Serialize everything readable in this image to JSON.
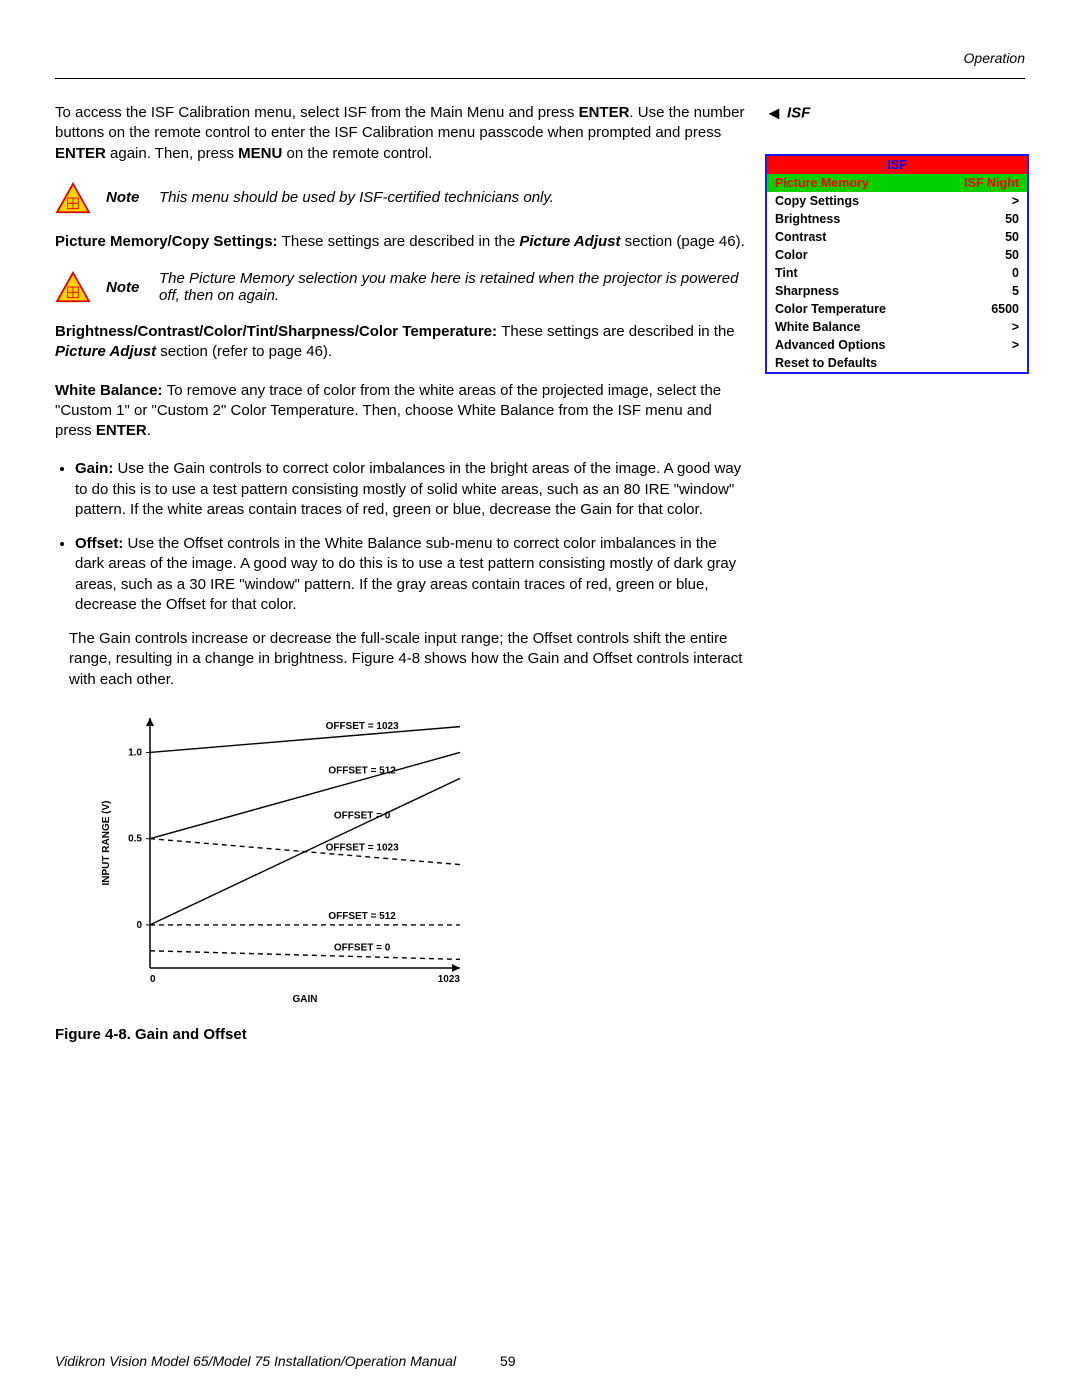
{
  "header": {
    "section": "Operation"
  },
  "side": {
    "heading": "ISF",
    "menu_title": "ISF",
    "highlight": {
      "label": "Picture Memory",
      "value": "ISF Night"
    },
    "rows": [
      {
        "label": "Copy Settings",
        "value": ">"
      },
      {
        "label": "Brightness",
        "value": "50"
      },
      {
        "label": "Contrast",
        "value": "50"
      },
      {
        "label": "Color",
        "value": "50"
      },
      {
        "label": "Tint",
        "value": "0"
      },
      {
        "label": "Sharpness",
        "value": "5"
      },
      {
        "label": "Color Temperature",
        "value": "6500"
      },
      {
        "label": "White Balance",
        "value": ">"
      },
      {
        "label": "Advanced Options",
        "value": ">"
      },
      {
        "label": "Reset to Defaults",
        "value": ""
      }
    ]
  },
  "intro": {
    "p1a": "To access the ISF Calibration menu, select ISF from the Main Menu and press ",
    "p1b": ". Use the number buttons on the remote control to enter the ISF Calibration menu passcode when prompted and press ",
    "p1c": " again. Then, press ",
    "p1d": " on the remote control.",
    "enter": "ENTER",
    "menu": "MENU"
  },
  "note1": "This menu should be used by ISF-certified technicians only.",
  "pm_copy": {
    "lead": "Picture Memory/Copy Settings: ",
    "body": "These settings are described in the ",
    "ref": "Picture Adjust",
    "tail": " section (page 46)."
  },
  "note2": "The Picture Memory selection you make here is retained when the projector is powered off, then on again.",
  "bcctsc": {
    "lead": "Brightness/Contrast/Color/Tint/Sharpness/Color Temperature: ",
    "body": "These settings are described in the ",
    "ref": "Picture Adjust",
    "tail": " section (refer to page 46)."
  },
  "wb": {
    "lead": "White Balance: ",
    "body": "To remove any trace of color from the white areas of the projected image, select the \"Custom 1\" or \"Custom 2\" Color Temperature. Then, choose White Balance from the ISF menu and press ",
    "enter": "ENTER",
    "tail": "."
  },
  "bullets": {
    "gain_lead": "Gain: ",
    "gain": "Use the Gain controls to correct color imbalances in the bright areas of the image. A good way to do this is to use a test pattern consisting mostly of solid white areas, such as an 80 IRE \"window\" pattern. If the white areas contain traces of red, green or blue, decrease the Gain for that color.",
    "offset_lead": "Offset: ",
    "offset": "Use the Offset controls in the White Balance sub-menu to correct color imbalances in the dark areas of the image. A good way to do this is to use a test pattern consisting mostly of dark gray areas, such as a 30 IRE \"window\" pattern. If the gray areas contain traces of red, green or blue, decrease the Offset for that color."
  },
  "gain_offset_para": "The Gain controls increase or decrease the full-scale input range; the Offset controls shift the entire range, resulting in a change in brightness. Figure 4-8 shows how the Gain and Offset controls interact with each other.",
  "fig_caption": "Figure 4-8. Gain and Offset",
  "footer": {
    "title": "Vidikron Vision Model 65/Model 75 Installation/Operation Manual",
    "page": "59"
  },
  "chart_data": {
    "type": "line",
    "title": "",
    "xlabel": "GAIN",
    "ylabel": "INPUT RANGE (V)",
    "xlim": [
      0,
      1023
    ],
    "ylim": [
      -0.25,
      1.2
    ],
    "y_ticks": [
      "0",
      "0.5",
      "1.0"
    ],
    "x_ticks": [
      "0",
      "1023"
    ],
    "series": [
      {
        "name": "OFFSET = 1023",
        "style": "solid",
        "points": [
          [
            0,
            1.0
          ],
          [
            1023,
            1.15
          ]
        ]
      },
      {
        "name": "OFFSET = 512",
        "style": "solid",
        "points": [
          [
            0,
            0.5
          ],
          [
            1023,
            1.0
          ]
        ]
      },
      {
        "name": "OFFSET = 0",
        "style": "solid",
        "points": [
          [
            0,
            0.0
          ],
          [
            1023,
            0.85
          ]
        ]
      },
      {
        "name": "OFFSET = 1023",
        "style": "dashed",
        "points": [
          [
            0,
            0.5
          ],
          [
            1023,
            0.35
          ]
        ]
      },
      {
        "name": "OFFSET = 512",
        "style": "dashed",
        "points": [
          [
            0,
            0.0
          ],
          [
            1023,
            0.0
          ]
        ]
      },
      {
        "name": "OFFSET = 0",
        "style": "dashed",
        "points": [
          [
            0,
            -0.15
          ],
          [
            1023,
            -0.2
          ]
        ]
      }
    ]
  }
}
